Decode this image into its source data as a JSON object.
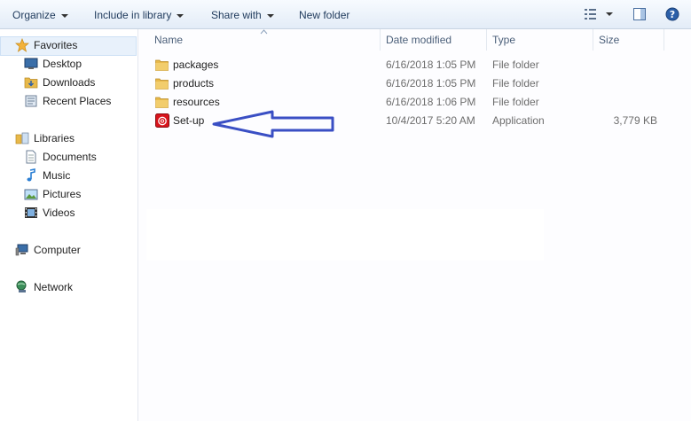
{
  "toolbar": {
    "organize": "Organize",
    "include": "Include in library",
    "share": "Share with",
    "newfolder": "New folder"
  },
  "nav": {
    "favorites": "Favorites",
    "desktop": "Desktop",
    "downloads": "Downloads",
    "recent": "Recent Places",
    "libraries": "Libraries",
    "documents": "Documents",
    "music": "Music",
    "pictures": "Pictures",
    "videos": "Videos",
    "computer": "Computer",
    "network": "Network"
  },
  "columns": {
    "name": "Name",
    "date": "Date modified",
    "type": "Type",
    "size": "Size"
  },
  "files": [
    {
      "name": "packages",
      "date": "6/16/2018 1:05 PM",
      "type": "File folder",
      "size": "",
      "icon": "folder-icon"
    },
    {
      "name": "products",
      "date": "6/16/2018 1:05 PM",
      "type": "File folder",
      "size": "",
      "icon": "folder-icon"
    },
    {
      "name": "resources",
      "date": "6/16/2018 1:06 PM",
      "type": "File folder",
      "size": "",
      "icon": "folder-icon"
    },
    {
      "name": "Set-up",
      "date": "10/4/2017 5:20 AM",
      "type": "Application",
      "size": "3,779 KB",
      "icon": "adobe-setup-icon"
    }
  ],
  "colors": {
    "annotation_arrow": "#3a4fc4",
    "toolbar_text": "#1e395b",
    "folder": "#e8b94a"
  }
}
